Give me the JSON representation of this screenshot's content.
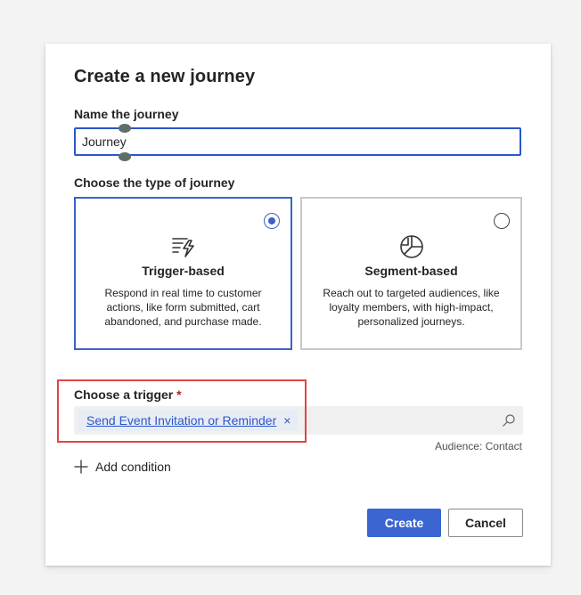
{
  "dialog": {
    "title": "Create a new journey",
    "name_label": "Name the journey",
    "name_value": "Journey",
    "type_label": "Choose the type of journey"
  },
  "journey_types": [
    {
      "title": "Trigger-based",
      "description": "Respond in real time to customer actions, like form submitted, cart abandoned, and purchase made.",
      "selected": true,
      "icon": "lightning-lines-icon"
    },
    {
      "title": "Segment-based",
      "description": "Reach out to targeted audiences, like loyalty members, with high-impact, personalized journeys.",
      "selected": false,
      "icon": "pie-segments-icon"
    }
  ],
  "trigger": {
    "label": "Choose a trigger",
    "required_mark": "*",
    "selected_value": "Send Event Invitation or Reminder",
    "remove_glyph": "×",
    "audience": "Audience: Contact"
  },
  "add_condition_label": "Add condition",
  "buttons": {
    "create": "Create",
    "cancel": "Cancel"
  },
  "colors": {
    "accent": "#3b66d1",
    "highlight": "#e04545"
  }
}
